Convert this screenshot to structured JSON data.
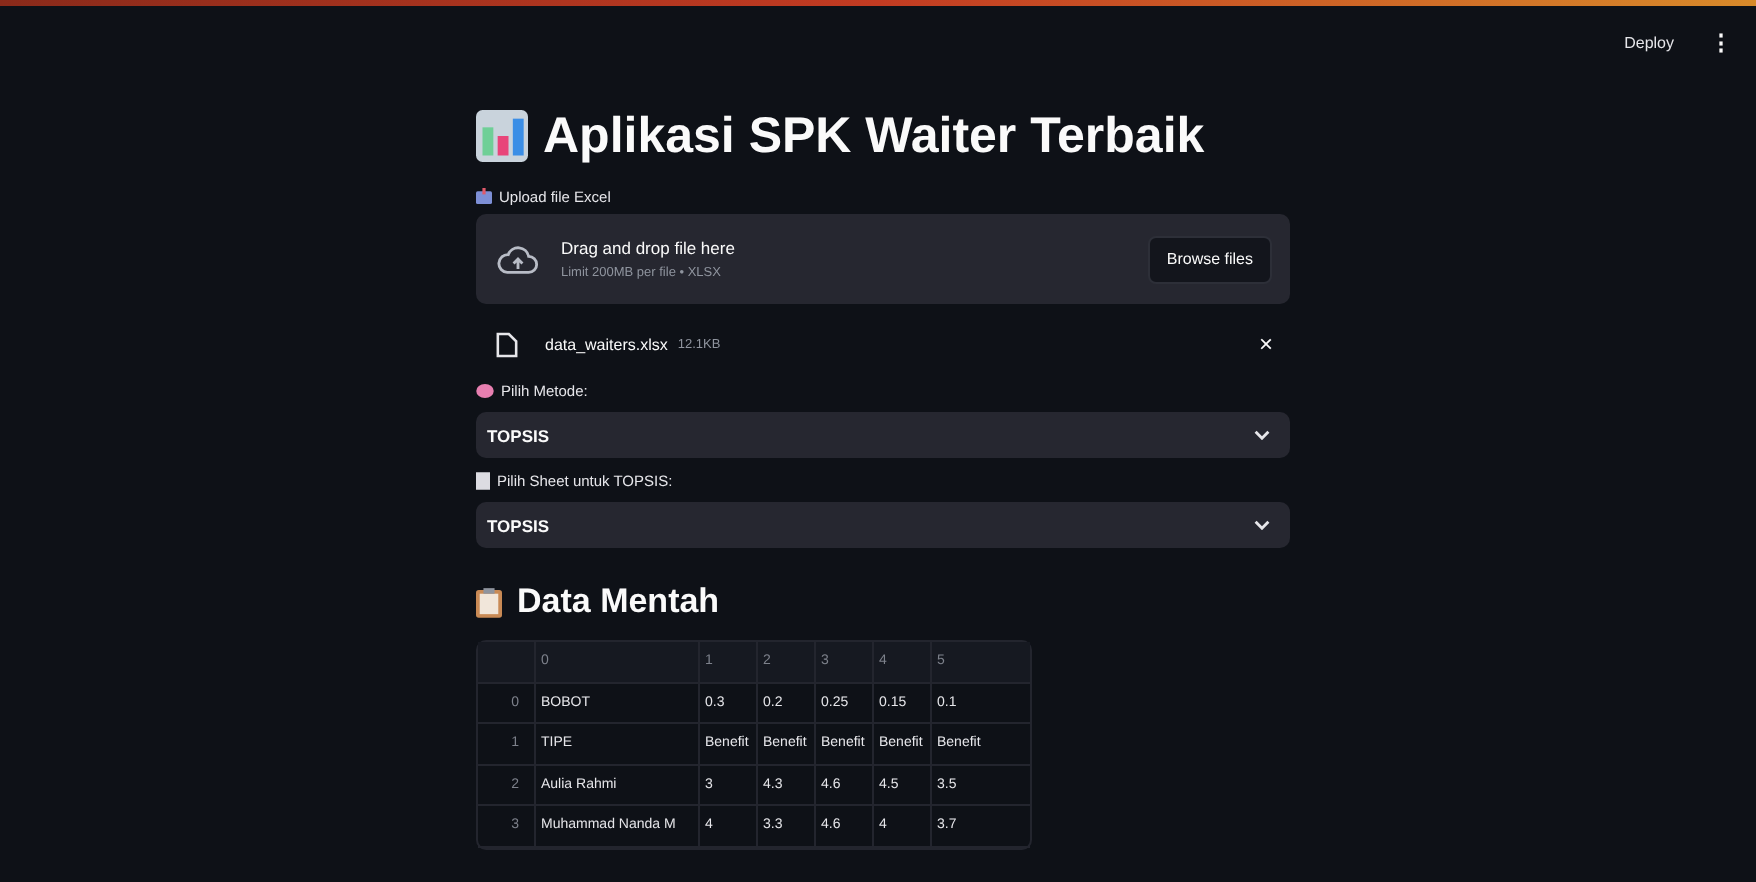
{
  "header": {
    "deploy": "Deploy",
    "menu": "⋮"
  },
  "title": "Aplikasi SPK Waiter Terbaik",
  "uploader": {
    "label": "Upload file Excel",
    "drop_text": "Drag and drop file here",
    "limit_text": "Limit 200MB per file • XLSX",
    "button": "Browse files"
  },
  "file": {
    "name": "data_waiters.xlsx",
    "size": "12.1KB",
    "remove": "×"
  },
  "selects": [
    {
      "label": "Pilih Metode:",
      "value": "TOPSIS"
    },
    {
      "label": "Pilih Sheet untuk TOPSIS:",
      "value": "TOPSIS"
    }
  ],
  "section": {
    "title": "Data Mentah"
  },
  "table": {
    "columns": [
      "0",
      "1",
      "2",
      "3",
      "4",
      "5"
    ],
    "rows": [
      {
        "index": "0",
        "cells": [
          "BOBOT",
          "0.3",
          "0.2",
          "0.25",
          "0.15",
          "0.1"
        ]
      },
      {
        "index": "1",
        "cells": [
          "TIPE",
          "Benefit",
          "Benefit",
          "Benefit",
          "Benefit",
          "Benefit"
        ]
      },
      {
        "index": "2",
        "cells": [
          "Aulia Rahmi",
          "3",
          "4.3",
          "4.6",
          "4.5",
          "3.5"
        ]
      },
      {
        "index": "3",
        "cells": [
          "Muhammad Nanda M",
          "4",
          "3.3",
          "4.6",
          "4",
          "3.7"
        ]
      }
    ]
  }
}
